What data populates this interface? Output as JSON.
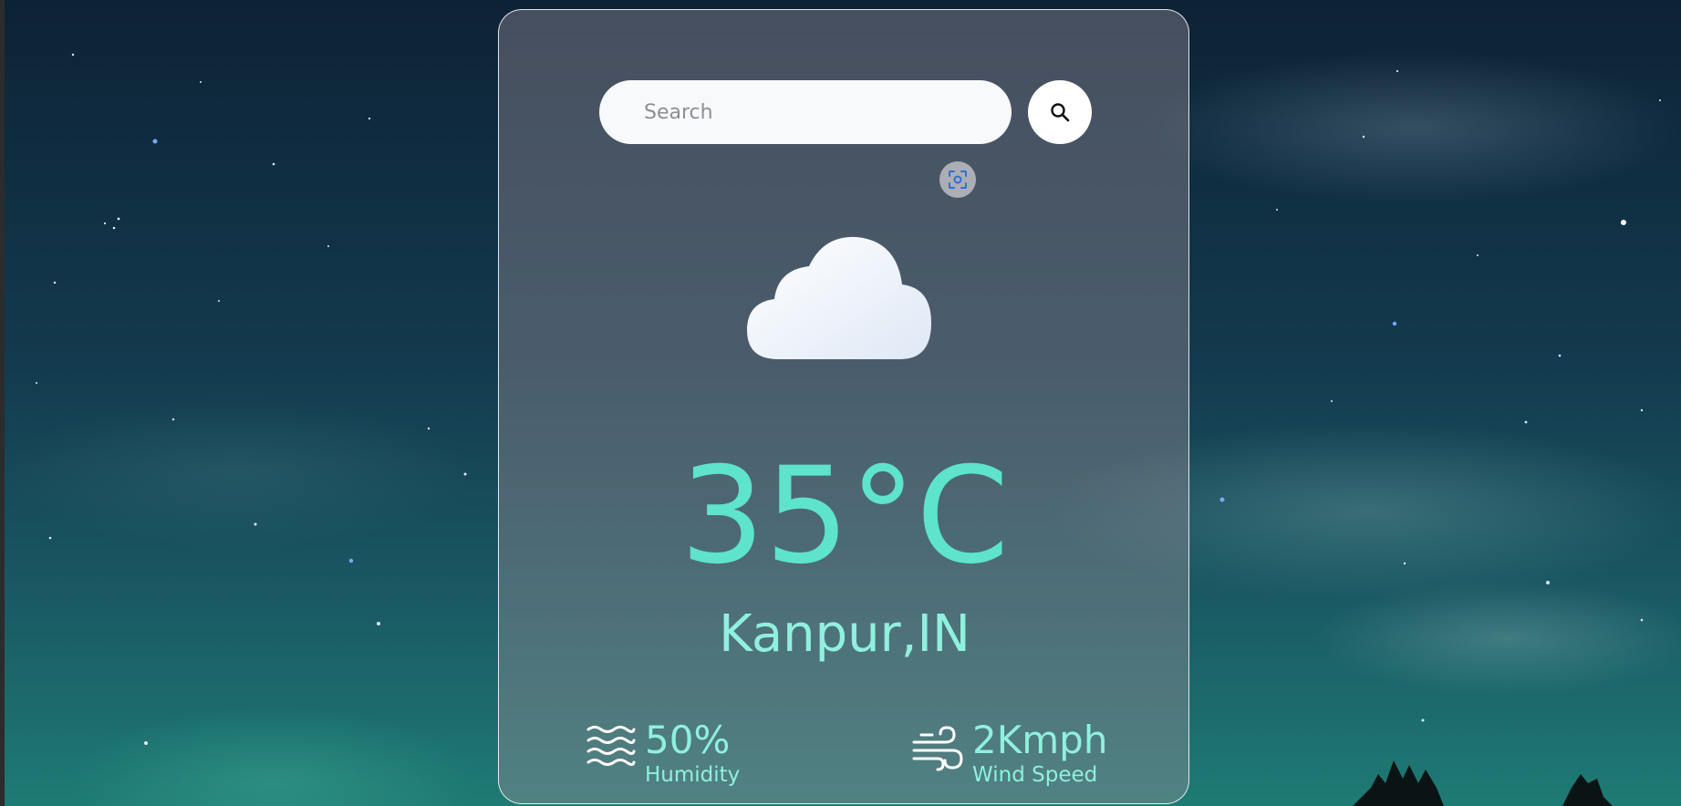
{
  "search": {
    "placeholder": "Search",
    "value": ""
  },
  "weather": {
    "condition_icon": "cloud-icon",
    "temperature": "35°C",
    "location": "Kanpur,IN"
  },
  "humidity": {
    "icon": "waves-icon",
    "value": "50%",
    "label": "Humidity"
  },
  "wind": {
    "icon": "wind-icon",
    "value": "2Kmph",
    "label": "Wind Speed"
  },
  "icons": {
    "search_button": "search-icon",
    "scan_button": "scan-icon"
  },
  "colors": {
    "accent_temperature": "#5ee3cc",
    "accent_text": "#8ff0de",
    "card_border": "#ffffff"
  }
}
